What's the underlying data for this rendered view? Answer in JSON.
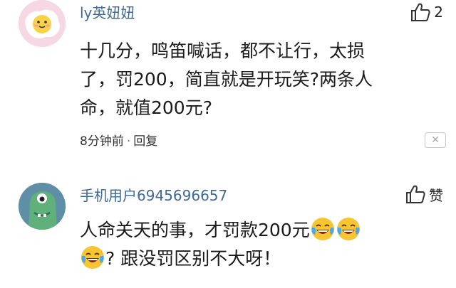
{
  "comments": [
    {
      "username": "ly英妞妞",
      "likes": "2",
      "lines": [
        "十几分，鸣笛喊话，都不让行，太损",
        "了，罚200，简直就是开玩笑?两条人",
        "命，就值200元?"
      ],
      "time": "8分钟前",
      "separator": "·",
      "reply": "回复",
      "close": "✕",
      "avatar_icon": "fried-egg-face",
      "thumb_icon": "thumbs-up-outline"
    },
    {
      "username": "手机用户6945696657",
      "like_label": "赞",
      "line1": "人命关天的事，才罚款200元",
      "line2": "? 跟没罚区别不大呀！",
      "avatar_icon": "green-monster-face",
      "thumb_icon": "thumbs-up-outline",
      "emoji_icon": "crying-laughing-face"
    }
  ],
  "colors": {
    "username": "#3e6a98",
    "text": "#1a1a1a",
    "avatar1_bg": "#f6d8e4",
    "avatar2_bg": "#5f8fa6",
    "emoji_yellow": "#f7c531",
    "tears_blue": "#4aa8e8"
  }
}
